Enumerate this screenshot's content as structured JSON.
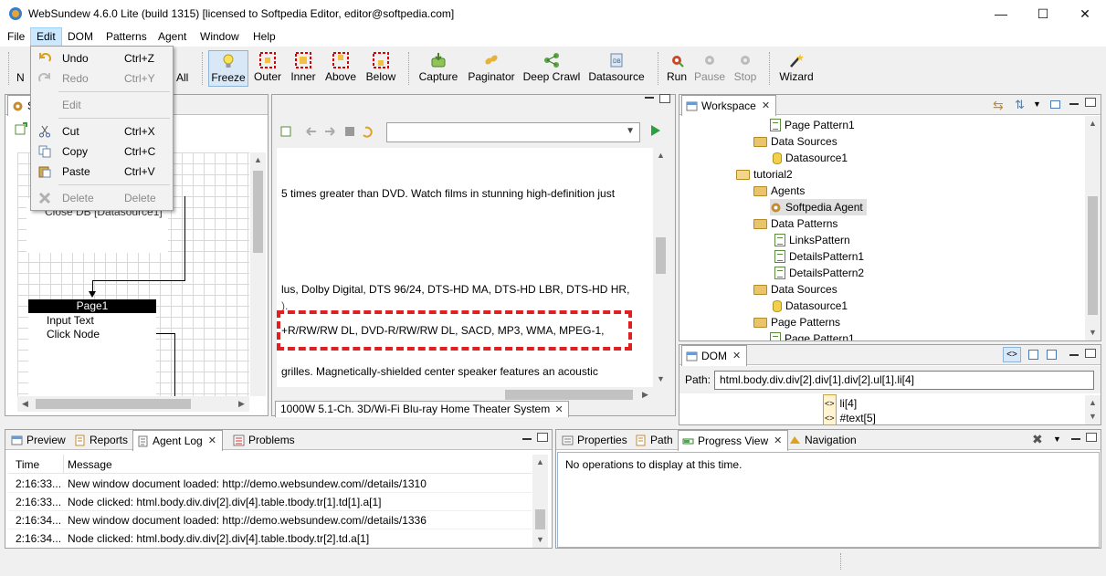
{
  "window": {
    "title": "WebSundew 4.6.0 Lite (build 1315) [licensed to Softpedia Editor, editor@softpedia.com]",
    "minimize": "—",
    "maximize": "☐",
    "close": "✕"
  },
  "menubar": [
    "File",
    "Edit",
    "DOM",
    "Patterns",
    "Agent",
    "Window",
    "Help"
  ],
  "edit_menu": {
    "undo": "Undo",
    "undo_sc": "Ctrl+Z",
    "redo": "Redo",
    "redo_sc": "Ctrl+Y",
    "edit": "Edit",
    "cut": "Cut",
    "cut_sc": "Ctrl+X",
    "copy": "Copy",
    "copy_sc": "Ctrl+C",
    "paste": "Paste",
    "paste_sc": "Ctrl+V",
    "delete": "Delete",
    "delete_sc": "Delete"
  },
  "toolbar": {
    "n_partial": "N",
    "all_partial": "All",
    "freeze": "Freeze",
    "outer": "Outer",
    "inner": "Inner",
    "above": "Above",
    "below": "Below",
    "capture": "Capture",
    "paginator": "Paginator",
    "deep_crawl": "Deep Crawl",
    "datasource": "Datasource",
    "run": "Run",
    "pause": "Pause",
    "stop": "Stop",
    "wizard": "Wizard"
  },
  "left_panel": {
    "tab_partial": "S",
    "close_db": "Close DB [Datasource1]",
    "page1": "Page1",
    "input_text": "Input Text",
    "click_node": "Click Node"
  },
  "browser": {
    "lines": [
      "5 times greater than DVD. Watch films in stunning high-definition just",
      "lus, Dolby Digital, DTS 96/24, DTS-HD MA, DTS-HD LBR, DTS-HD HR,",
      "+R/RW/RW DL, DVD-R/RW/RW DL, SACD, MP3, WMA, MPEG-1,",
      "grilles. Magnetically-shielded center speaker features an acoustic"
    ],
    "tab_title": "1000W 5.1-Ch. 3D/Wi-Fi Blu-ray Home Theater System"
  },
  "workspace": {
    "tab": "Workspace",
    "items": [
      "Page Pattern1",
      "Data Sources",
      "Datasource1",
      "tutorial2",
      "Agents",
      "Softpedia Agent",
      "Data Patterns",
      "LinksPattern",
      "DetailsPattern1",
      "DetailsPattern2",
      "Data Sources",
      "Datasource1",
      "Page Patterns",
      "Page Pattern1"
    ]
  },
  "dom": {
    "tab": "DOM",
    "path_label": "Path:",
    "path_value": "html.body.div.div[2].div[1].div[2].ul[1].li[4]",
    "nodes": [
      "li[4]",
      "#text[5]"
    ]
  },
  "bottom_left": {
    "tabs": [
      "Preview",
      "Reports",
      "Agent Log",
      "Problems"
    ],
    "col_time": "Time",
    "col_message": "Message",
    "rows": [
      {
        "time": "2:16:33...",
        "message": "New window document loaded: http://demo.websundew.com//details/1310"
      },
      {
        "time": "2:16:33...",
        "message": "Node clicked: html.body.div.div[2].div[4].table.tbody.tr[1].td[1].a[1]"
      },
      {
        "time": "2:16:34...",
        "message": "New window document loaded: http://demo.websundew.com//details/1336"
      },
      {
        "time": "2:16:34...",
        "message": "Node clicked: html.body.div.div[2].div[4].table.tbody.tr[2].td.a[1]"
      }
    ]
  },
  "bottom_right": {
    "tabs": [
      "Properties",
      "Path",
      "Progress View",
      "Navigation"
    ],
    "message": "No operations to display at this time."
  }
}
